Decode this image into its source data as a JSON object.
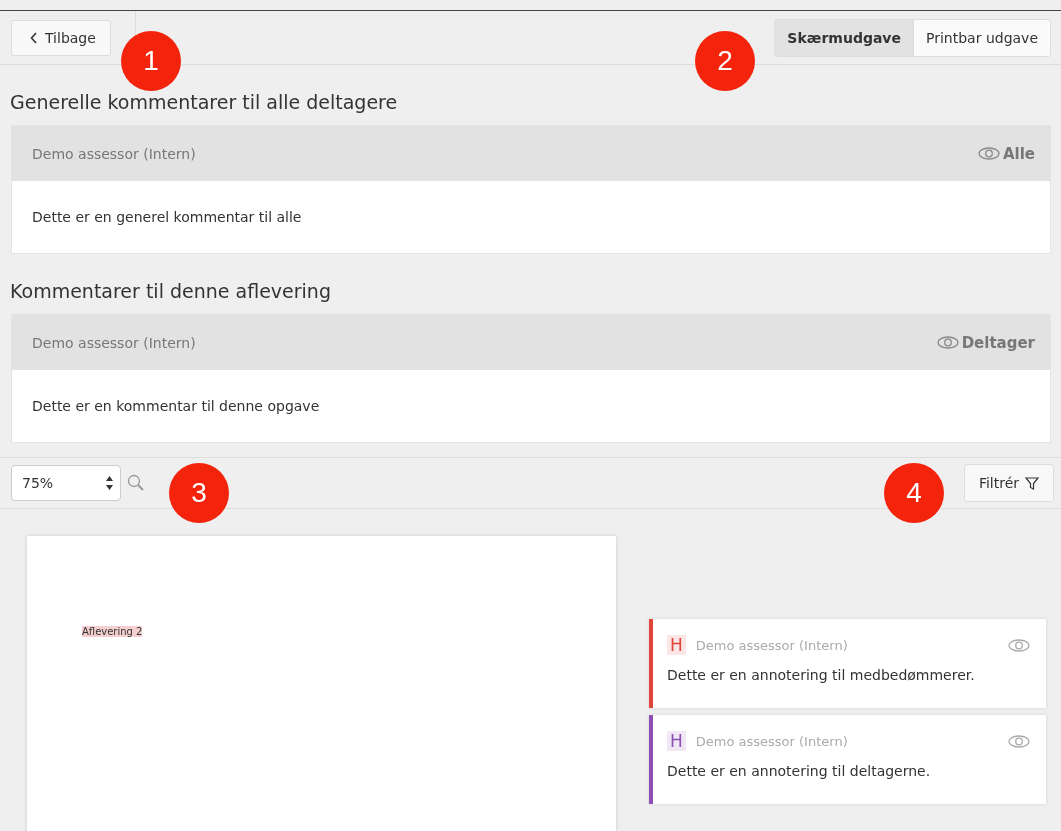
{
  "toolbar": {
    "back_button": "Tilbage",
    "view_toggle": [
      {
        "label": "Skærmudgave",
        "selected": true
      },
      {
        "label": "Printbar udgave",
        "selected": false
      }
    ]
  },
  "sections": [
    {
      "heading": "Generelle kommentarer til alle deltagere",
      "author": "Demo assessor (Intern)",
      "visibility": "Alle",
      "comment": "Dette er en generel kommentar til alle"
    },
    {
      "heading": "Kommentarer til denne aflevering",
      "author": "Demo assessor (Intern)",
      "visibility": "Deltager",
      "comment": "Dette er en kommentar til denne opgave"
    }
  ],
  "viewer": {
    "zoom": "75%",
    "filter_button": "Filtrér",
    "document_text": "Aflevering 2"
  },
  "annotations": [
    {
      "marker": "H",
      "color": "#e0443a",
      "author": "Demo assessor (Intern)",
      "text": "Dette er en annotering til medbedømmerer."
    },
    {
      "marker": "H",
      "color": "#8e4fb5",
      "author": "Demo assessor (Intern)",
      "text": "Dette er en annotering til deltagerne."
    }
  ],
  "callouts": [
    "1",
    "2",
    "3",
    "4"
  ]
}
